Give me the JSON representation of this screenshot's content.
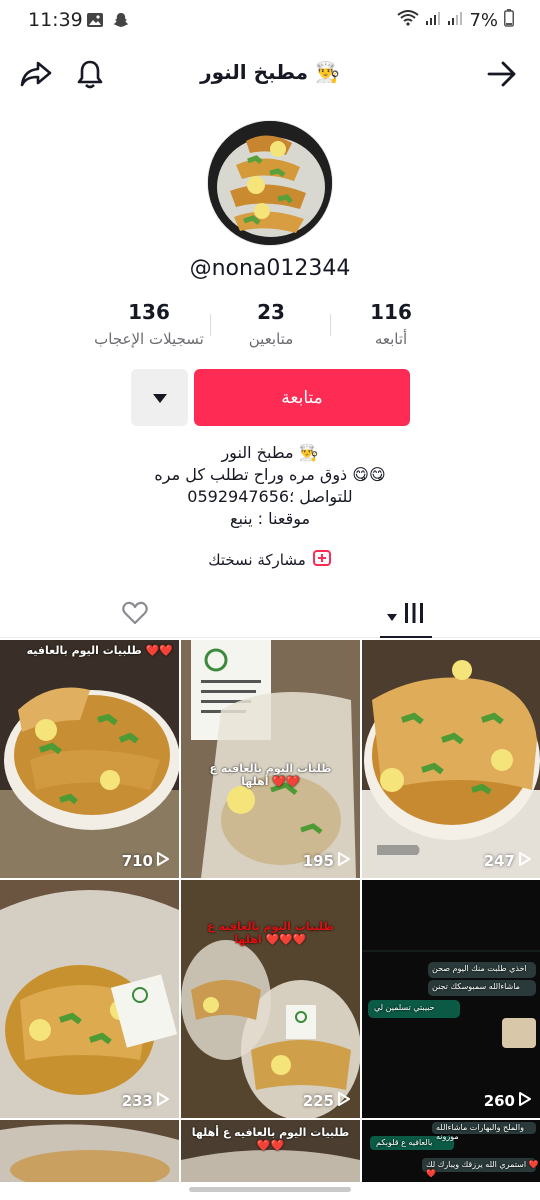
{
  "status_bar": {
    "time": "11:39",
    "battery": "7%"
  },
  "header": {
    "title": "مطبخ النور 👨‍🍳"
  },
  "profile": {
    "username": "@nona012344"
  },
  "stats": [
    {
      "value": "116",
      "label": "أتابعه"
    },
    {
      "value": "23",
      "label": "متابعين"
    },
    {
      "value": "136",
      "label": "تسجيلات الإعجاب"
    }
  ],
  "actions": {
    "follow": "متابعة"
  },
  "bio": {
    "line1": "مطبخ النور 👨‍🍳",
    "line2": "ذوق مره وراح تطلب كل مره 😋😋",
    "line3": "للتواصل ؛0592947656",
    "line4": "موقعنا : ينبع"
  },
  "share": {
    "label": "مشاركة نسختك"
  },
  "videos": [
    {
      "views": "710",
      "overlay": "طلبيات اليوم بالعافيه ❤️❤️"
    },
    {
      "views": "195",
      "overlay": "طلبات اليوم بالعافيه ع أهلها ❤️❤️"
    },
    {
      "views": "247",
      "overlay": ""
    },
    {
      "views": "233",
      "overlay": ""
    },
    {
      "views": "225",
      "overlay": "طلبيات اليوم بالعافيه ع اهلها ❤️❤️❤️"
    },
    {
      "views": "260",
      "overlay": ""
    },
    {
      "views": "",
      "overlay": ""
    },
    {
      "views": "",
      "overlay": "طلبيات اليوم بالعافيه ع أهلها ❤️❤️"
    },
    {
      "views": "",
      "overlay": ""
    }
  ],
  "chat_lines": [
    "اخذي طلبت منك اليوم صحن",
    "ماشاءالله سمبوسكك تجنن",
    "حبيبتي تسلمين لي",
    "والملح والبهارات ماشاءالله موزونه",
    "بالعافيه ع قلوبكم",
    "استمري الله يرزقك ويبارك لك ❤️❤️"
  ],
  "colors": {
    "accent": "#fe2c55",
    "text": "#161823"
  }
}
